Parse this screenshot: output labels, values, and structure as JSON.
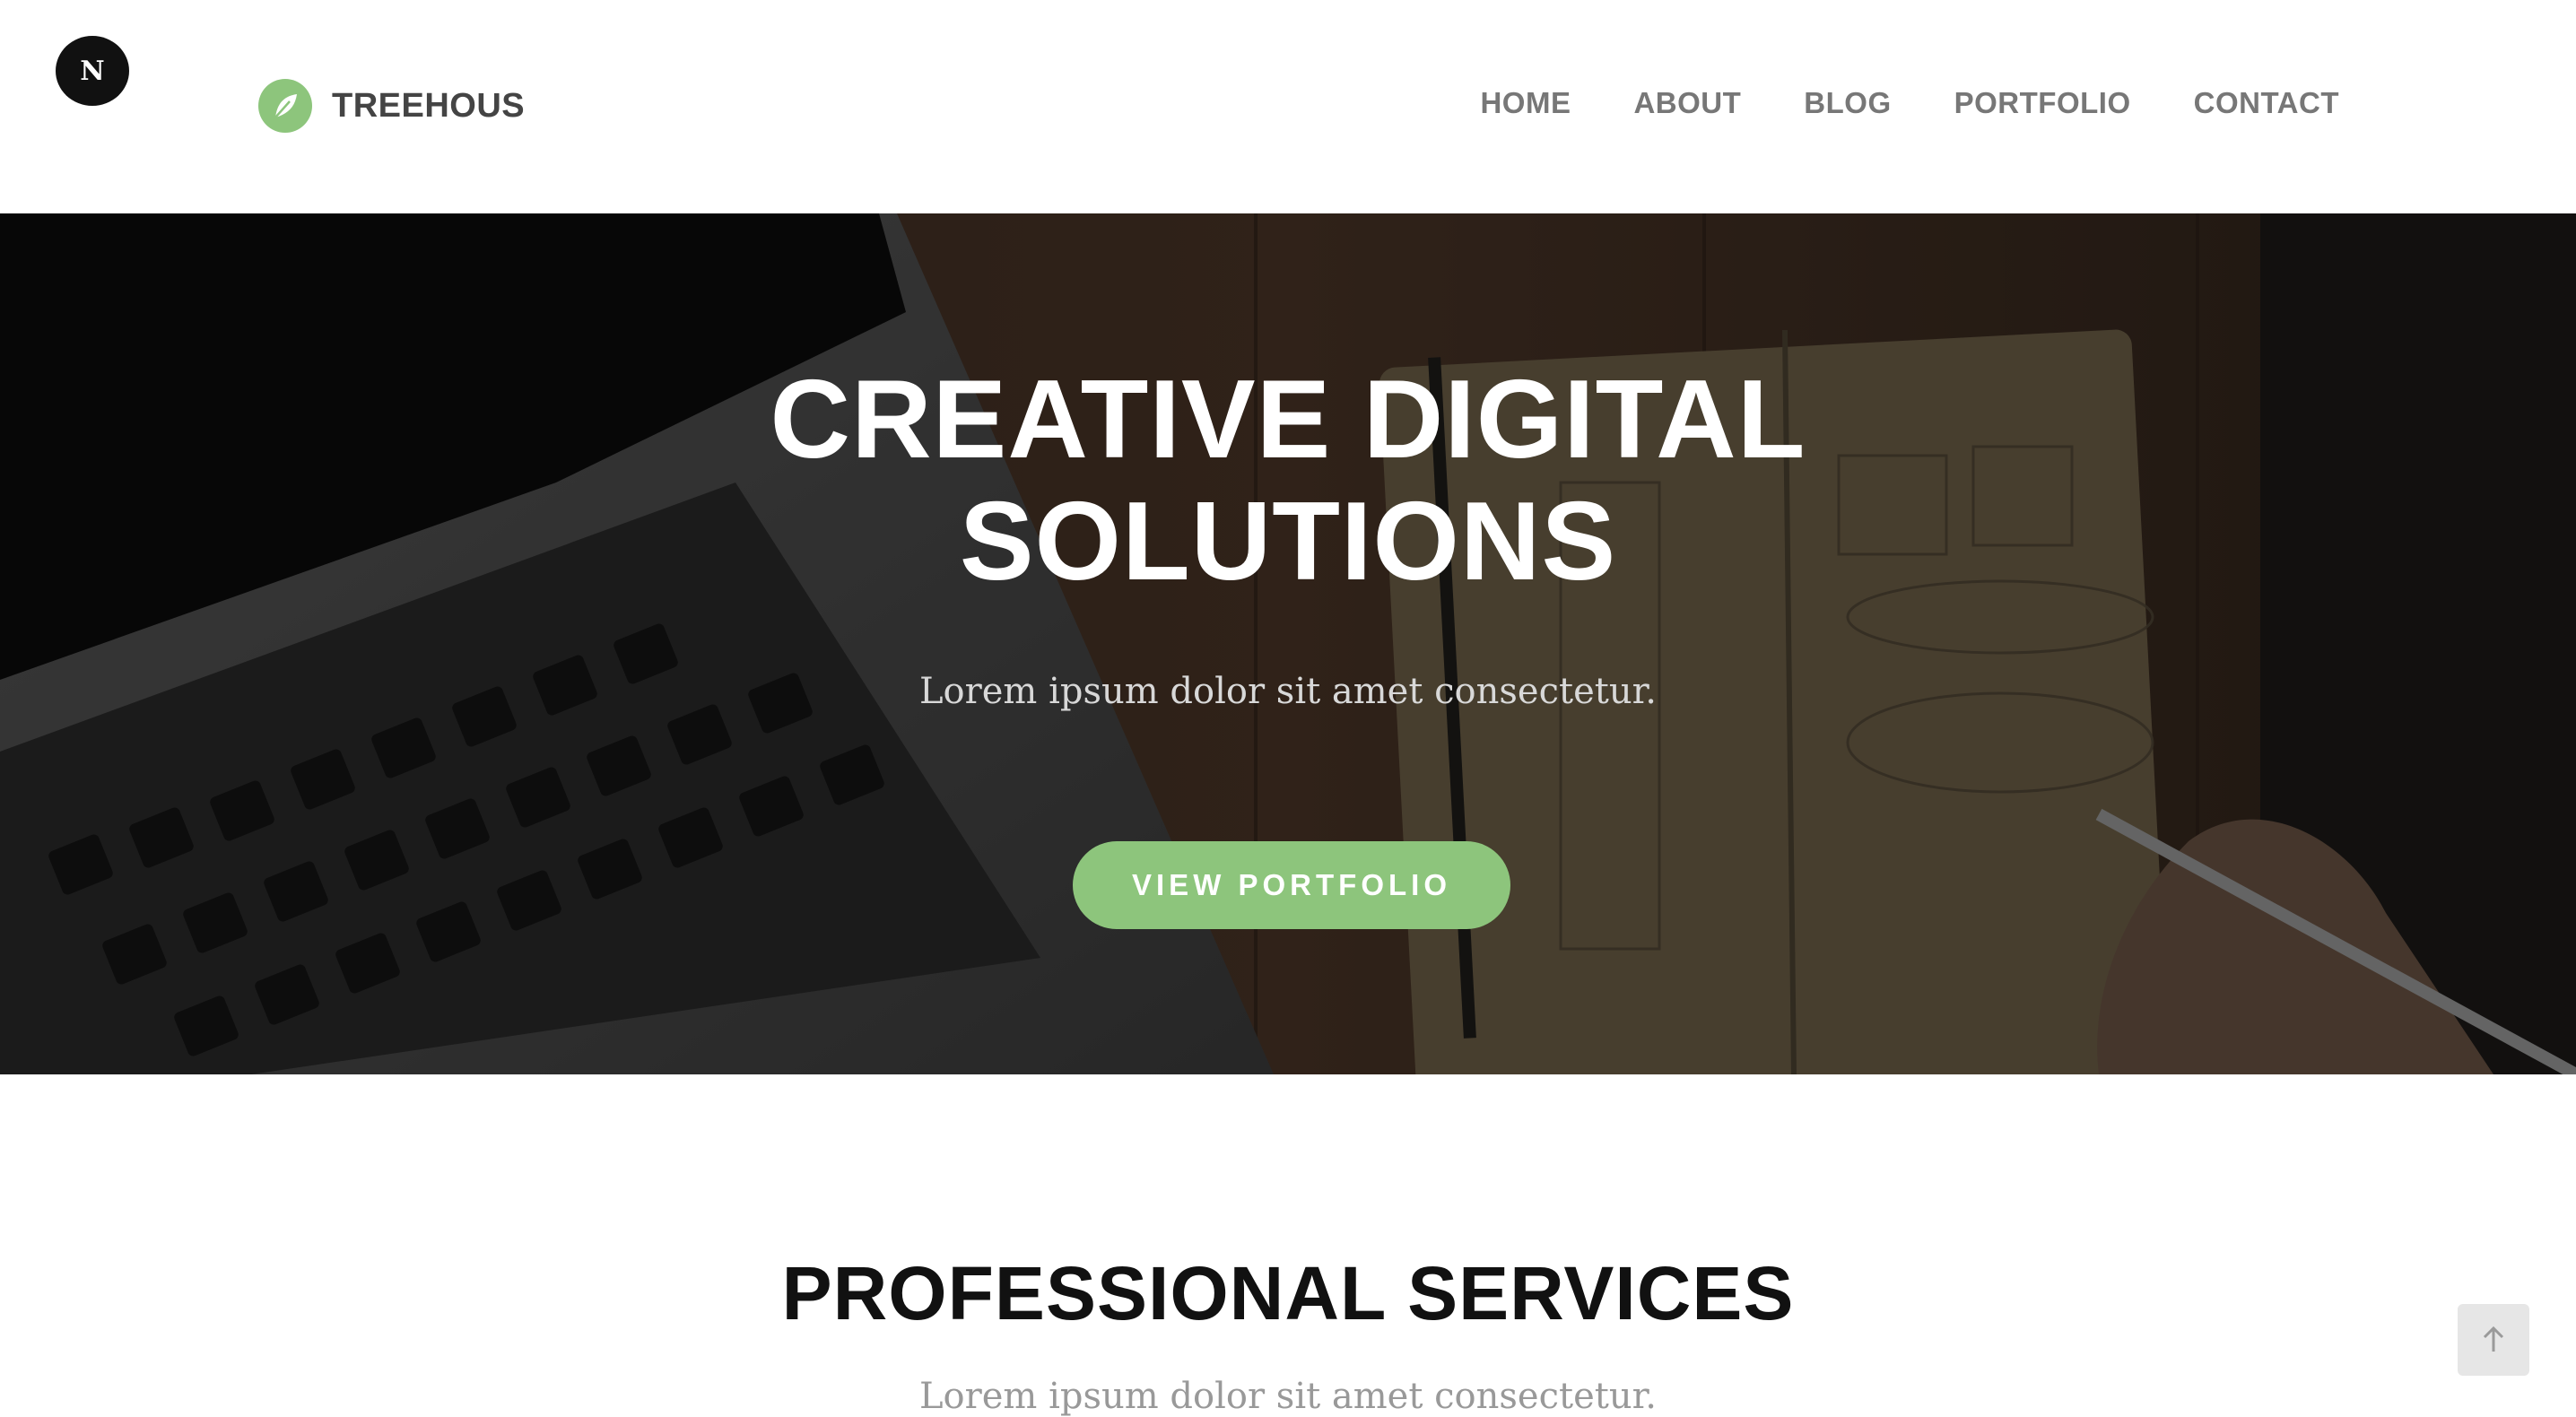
{
  "badge": {
    "letter": "N"
  },
  "brand": {
    "name": "TREEHOUS",
    "accent_color": "#8dc57c",
    "icon": "leaf-icon"
  },
  "nav": {
    "items": [
      {
        "label": "HOME"
      },
      {
        "label": "ABOUT"
      },
      {
        "label": "BLOG"
      },
      {
        "label": "PORTFOLIO"
      },
      {
        "label": "CONTACT"
      }
    ]
  },
  "hero": {
    "title_line1": "CREATIVE DIGITAL",
    "title_line2": "SOLUTIONS",
    "subtitle": "Lorem ipsum dolor sit amet consectetur.",
    "cta_label": "VIEW PORTFOLIO",
    "cta_color": "#8dc57c"
  },
  "services": {
    "title": "PROFESSIONAL SERVICES",
    "subtitle": "Lorem ipsum dolor sit amet consectetur."
  },
  "scroll_top": {
    "icon": "arrow-up-icon"
  }
}
